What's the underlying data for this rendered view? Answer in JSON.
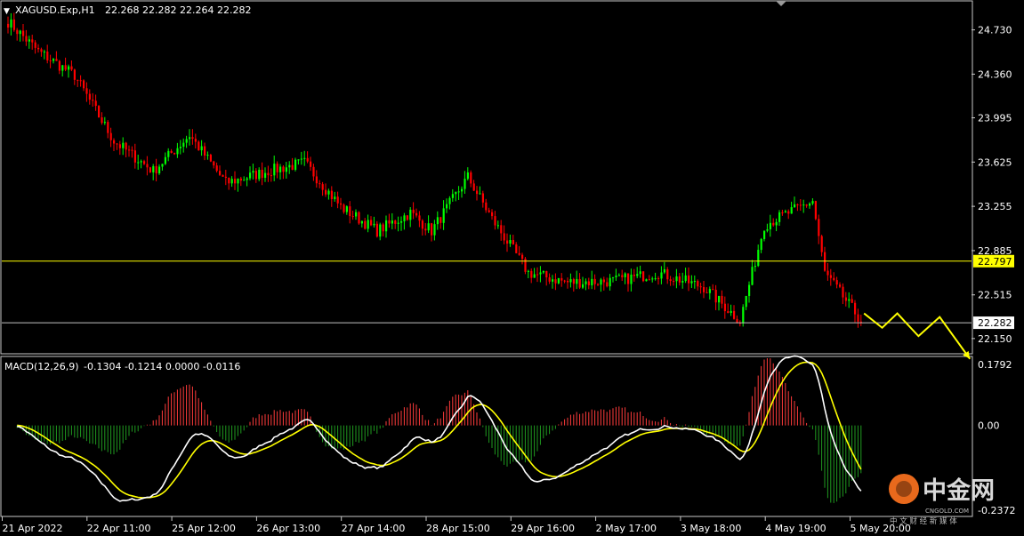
{
  "header": {
    "symbol_title": "XAGUSD.Exp,H1",
    "ohlc": "22.268 22.282 22.264 22.282",
    "dropdown_glyph": "▼"
  },
  "macd": {
    "title": "MACD(12,26,9)",
    "values": "-0.1304 -0.1214 0.0000 -0.0116"
  },
  "watermark": {
    "brand_text": "中金网",
    "url_text": "CNGOLD.COM",
    "tagline": "中 文 财 经 新 媒 体"
  },
  "colors": {
    "bg": "#000000",
    "bull": "#00ff00",
    "bear": "#ff0000",
    "macd_line": "#ffffff",
    "signal_line": "#ffff00",
    "hist_pos": "#ff3b3b",
    "hist_neg": "#1f9a1f",
    "hline_yellow": "#ffff00",
    "hline_gray": "#c0c0c0",
    "arrow": "#ffff00",
    "logo_orange": "#e8691c"
  },
  "chart_data": [
    {
      "type": "candlestick",
      "title": "XAGUSD.Exp,H1",
      "ylim": [
        22.03,
        24.95
      ],
      "y_ticks": [
        24.73,
        24.36,
        23.995,
        23.625,
        23.255,
        22.885,
        22.515,
        22.15
      ],
      "y_tick_labels": [
        "24.730",
        "24.360",
        "23.995",
        "23.625",
        "23.255",
        "22.885",
        "22.515",
        "22.150"
      ],
      "x_tick_labels": [
        "21 Apr 2022",
        "22 Apr 11:00",
        "25 Apr 12:00",
        "26 Apr 13:00",
        "27 Apr 14:00",
        "28 Apr 15:00",
        "29 Apr 16:00",
        "2 May 17:00",
        "3 May 18:00",
        "4 May 19:00",
        "5 May 20:00"
      ],
      "horizontal_lines": [
        {
          "value": 22.797,
          "label": "22.797",
          "color": "#ffff00"
        },
        {
          "value": 22.282,
          "label": "22.282",
          "color": "#c0c0c0"
        }
      ],
      "trend_anchors": [
        [
          0,
          24.8
        ],
        [
          10,
          24.55
        ],
        [
          22,
          24.35
        ],
        [
          35,
          23.8
        ],
        [
          48,
          23.55
        ],
        [
          60,
          23.85
        ],
        [
          72,
          23.45
        ],
        [
          86,
          23.55
        ],
        [
          98,
          23.62
        ],
        [
          110,
          23.25
        ],
        [
          122,
          23.05
        ],
        [
          133,
          23.2
        ],
        [
          140,
          23.05
        ],
        [
          152,
          23.5
        ],
        [
          160,
          23.15
        ],
        [
          172,
          22.7
        ],
        [
          185,
          22.62
        ],
        [
          200,
          22.63
        ],
        [
          215,
          22.7
        ],
        [
          230,
          22.58
        ],
        [
          242,
          22.3
        ],
        [
          250,
          23.1
        ],
        [
          258,
          23.2
        ],
        [
          266,
          23.3
        ],
        [
          270,
          22.7
        ],
        [
          282,
          22.3
        ]
      ],
      "candle_count": 283,
      "projection_arrow": [
        {
          "x": 283,
          "y": 22.36
        },
        {
          "x": 289,
          "y": 22.24
        },
        {
          "x": 294,
          "y": 22.36
        },
        {
          "x": 301,
          "y": 22.17
        },
        {
          "x": 308,
          "y": 22.33
        },
        {
          "x": 318,
          "y": 21.98
        }
      ]
    },
    {
      "type": "macd",
      "title": "MACD(12,26,9)",
      "ylim": [
        -0.2372,
        0.1792
      ],
      "y_ticks": [
        0.1792,
        0.0,
        -0.2372
      ],
      "y_tick_labels": [
        "0.1792",
        "0.00",
        "-0.2372"
      ],
      "current": {
        "macd": -0.1304,
        "signal": -0.1214,
        "value3": 0.0,
        "value4": -0.0116
      }
    }
  ]
}
